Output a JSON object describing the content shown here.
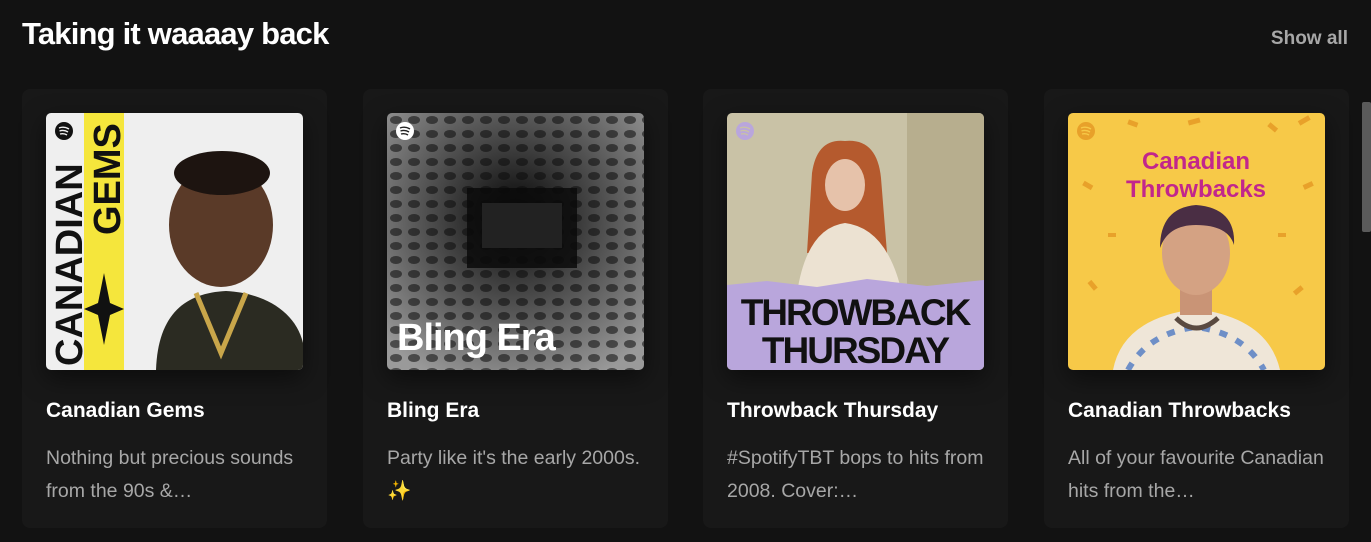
{
  "section": {
    "title": "Taking it waaaay back",
    "show_all": "Show all"
  },
  "cards": [
    {
      "title": "Canadian Gems",
      "description": "Nothing but precious sounds from the 90s &…",
      "cover_text": [
        "CANADIAN",
        "GEMS"
      ],
      "cover_colors": {
        "accent": "#f5e63c",
        "bg": "#f2f2f2"
      }
    },
    {
      "title": "Bling Era",
      "description": "Party like it's the early 2000s. ✨",
      "cover_text": "Bling Era",
      "cover_colors": {
        "bg": "#2a2a2a"
      }
    },
    {
      "title": "Throwback Thursday",
      "description": "#SpotifyTBT bops to hits from 2008. Cover:…",
      "cover_text": [
        "THROWBACK",
        "THURSDAY"
      ],
      "cover_colors": {
        "band": "#b9a6dc",
        "bg": "#c9c2a6"
      }
    },
    {
      "title": "Canadian Throwbacks",
      "description": "All of your favourite Canadian hits from the…",
      "cover_text": [
        "Canadian",
        "Throwbacks"
      ],
      "cover_colors": {
        "bg": "#f7c948",
        "text": "#c2268c"
      }
    }
  ],
  "icons": {
    "brand": "spotify-logo-icon"
  }
}
